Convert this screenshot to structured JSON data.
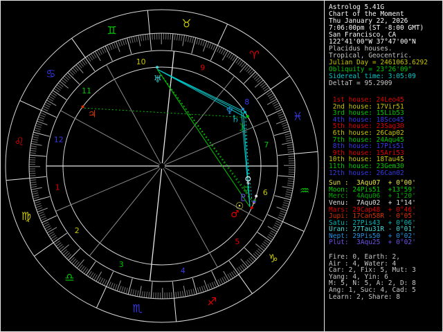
{
  "app": {
    "title": "Astrolog 5.41G"
  },
  "panel": {
    "header_lines": [
      {
        "text": "Astrolog 5.41G",
        "color": "#fcfcfc"
      },
      {
        "text": "Chart of the Moment",
        "color": "#fcfcfc"
      },
      {
        "text": "Thu January 22, 2026",
        "color": "#fcfcfc"
      },
      {
        "text": "7:06:00pm (ST -8:00 GMT)",
        "color": "#fcfcfc"
      },
      {
        "text": "San Francisco, CA",
        "color": "#fcfcfc"
      },
      {
        "text": "122°41'00\"W 37°47'00\"N",
        "color": "#fcfcfc"
      },
      {
        "text": "Placidus houses.",
        "color": "#c8c8c8"
      },
      {
        "text": "Tropical, Geocentric.",
        "color": "#c8c8c8"
      },
      {
        "text": "Julian Day = 2461063.6292",
        "color": "#c8c800"
      },
      {
        "text": "Obliquity = 23°26'09\"",
        "color": "#00c800"
      },
      {
        "text": "Sidereal time: 3:05:09",
        "color": "#00c8c8"
      },
      {
        "text": "DeltaT = 95.2909",
        "color": "#c8c8c8"
      }
    ],
    "houses": [
      {
        "text": " 1st house: 24Leo45",
        "color": "#e00000"
      },
      {
        "text": " 2nd house: 17Vir51",
        "color": "#c8c800"
      },
      {
        "text": " 3rd house: 15Lib53",
        "color": "#00c800"
      },
      {
        "text": " 4th house: 18Sco45",
        "color": "#3838e8"
      },
      {
        "text": " 5th house: 23Sag30",
        "color": "#e00000"
      },
      {
        "text": " 6th house: 26Cap02",
        "color": "#c8c800"
      },
      {
        "text": " 7th house: 24Aqu45",
        "color": "#00c800"
      },
      {
        "text": " 8th house: 17Pis51",
        "color": "#3838e8"
      },
      {
        "text": " 9th house: 15Ari53",
        "color": "#e00000"
      },
      {
        "text": "10th house: 18Tau45",
        "color": "#c8c800"
      },
      {
        "text": "11th house: 23Gem30",
        "color": "#00c800"
      },
      {
        "text": "12th house: 26Can02",
        "color": "#3838e8"
      }
    ],
    "planets": [
      {
        "text": "Sun :  3Aqu07  + 0°00'",
        "color": "#e8e840"
      },
      {
        "text": "Moon: 24Pis51  +13°59'",
        "color": "#00d000"
      },
      {
        "text": "Merc:  4Aqu06  + 1°20'",
        "color": "#00a800"
      },
      {
        "text": "Venu:  7Aqu02  + 1°14'",
        "color": "#e0e0e0"
      },
      {
        "text": "Mars: 29Cap48  + 0°46'",
        "color": "#e00000"
      },
      {
        "text": "Jupi: 17Can58R - 0°05'",
        "color": "#d83000"
      },
      {
        "text": "Satu: 27Pis43  + 0°06'",
        "color": "#00b8b8"
      },
      {
        "text": "Uran: 27Tau31R - 0°01'",
        "color": "#40d8d8"
      },
      {
        "text": "Nept: 29Pis50  + 0°02'",
        "color": "#2090e0"
      },
      {
        "text": "Plut:  3Aqu25  + 0°02'",
        "color": "#7050e8"
      }
    ],
    "tallies": [
      {
        "text": "Fire: 0, Earth: 2,",
        "color": "#c8c8c8"
      },
      {
        "text": "Air : 4, Water: 4",
        "color": "#c8c8c8"
      },
      {
        "text": "Car: 2, Fix: 5, Mut: 3",
        "color": "#c8c8c8"
      },
      {
        "text": "Yang: 4, Yin: 6",
        "color": "#c8c8c8"
      },
      {
        "text": "M: 5, N: 5, A: 2, D: 8",
        "color": "#c8c8c8"
      },
      {
        "text": "Ang: 1, Suc: 4, Cad: 5",
        "color": "#c8c8c8"
      },
      {
        "text": "Learn: 2, Share: 8",
        "color": "#c8c8c8"
      }
    ]
  },
  "wheel": {
    "ascendant_deg": 144.75,
    "signs": [
      {
        "name": "Aries",
        "glyph": "♈",
        "color": "#e00000"
      },
      {
        "name": "Taurus",
        "glyph": "♉",
        "color": "#c8c800"
      },
      {
        "name": "Gemini",
        "glyph": "♊",
        "color": "#00c800"
      },
      {
        "name": "Cancer",
        "glyph": "♋",
        "color": "#3838e8"
      },
      {
        "name": "Leo",
        "glyph": "♌",
        "color": "#e00000"
      },
      {
        "name": "Virgo",
        "glyph": "♍",
        "color": "#c8c800"
      },
      {
        "name": "Libra",
        "glyph": "♎",
        "color": "#00c800"
      },
      {
        "name": "Scorpio",
        "glyph": "♏",
        "color": "#3838e8"
      },
      {
        "name": "Sagittarius",
        "glyph": "♐",
        "color": "#e00000"
      },
      {
        "name": "Capricorn",
        "glyph": "♑",
        "color": "#c8c800"
      },
      {
        "name": "Aquarius",
        "glyph": "♒",
        "color": "#00c800"
      },
      {
        "name": "Pisces",
        "glyph": "♓",
        "color": "#3838e8"
      }
    ],
    "house_cusps_deg": [
      144.75,
      167.85,
      195.88,
      228.75,
      263.5,
      296.03,
      324.75,
      347.85,
      15.88,
      48.75,
      83.5,
      116.03
    ],
    "house_number_colors": [
      "#e00000",
      "#c8c800",
      "#00c800",
      "#3838e8",
      "#e00000",
      "#c8c800",
      "#00c800",
      "#3838e8",
      "#e00000",
      "#c8c800",
      "#00c800",
      "#3838e8"
    ],
    "planets": [
      {
        "name": "Sun",
        "glyph": "☉",
        "lon": 303.12,
        "dlon": 297.5,
        "color": "#e8e840"
      },
      {
        "name": "Moon",
        "glyph": "☽",
        "lon": 354.85,
        "dlon": 351.0,
        "color": "#00d000"
      },
      {
        "name": "Merc",
        "glyph": "☿",
        "lon": 304.1,
        "dlon": 309.5,
        "color": "#00a800"
      },
      {
        "name": "Venu",
        "glyph": "♀",
        "lon": 307.03,
        "dlon": 315.5,
        "color": "#e0e0e0"
      },
      {
        "name": "Mars",
        "glyph": "♂",
        "lon": 299.8,
        "dlon": 291.5,
        "color": "#e00000"
      },
      {
        "name": "Jupi",
        "glyph": "♃",
        "lon": 107.97,
        "dlon": 107.97,
        "color": "#d83000"
      },
      {
        "name": "Satu",
        "glyph": "♄",
        "lon": 357.72,
        "dlon": 357.5,
        "color": "#00b8b8"
      },
      {
        "name": "Uran",
        "glyph": "♅",
        "lon": 57.52,
        "dlon": 57.52,
        "color": "#40d8d8"
      },
      {
        "name": "Nept",
        "glyph": "♆",
        "lon": 359.83,
        "dlon": 364.0,
        "color": "#2090e0"
      },
      {
        "name": "Plut",
        "glyph": "♇",
        "lon": 303.42,
        "dlon": 303.5,
        "color": "#7050e8"
      }
    ],
    "aspects": [
      {
        "a": "Mars",
        "b": "Nept",
        "color": "#00c8c8",
        "dash": false
      },
      {
        "a": "Mars",
        "b": "Satu",
        "color": "#00c8c8",
        "dash": false
      },
      {
        "a": "Satu",
        "b": "Uran",
        "color": "#00c8c8",
        "dash": false
      },
      {
        "a": "Nept",
        "b": "Uran",
        "color": "#00c8c8",
        "dash": false
      },
      {
        "a": "Moon",
        "b": "Uran",
        "color": "#00c8c8",
        "dash": false
      },
      {
        "a": "Moon",
        "b": "Mars",
        "color": "#00c8c8",
        "dash": true
      },
      {
        "a": "Sun",
        "b": "Satu",
        "color": "#00c8c8",
        "dash": true
      },
      {
        "a": "Uran",
        "b": "Mars",
        "color": "#00c800",
        "dash": false
      },
      {
        "a": "Uran",
        "b": "Sun",
        "color": "#00c800",
        "dash": true
      },
      {
        "a": "Uran",
        "b": "Merc",
        "color": "#00c800",
        "dash": true
      },
      {
        "a": "Jupi",
        "b": "Moon",
        "color": "#00c800",
        "dash": true
      }
    ]
  }
}
